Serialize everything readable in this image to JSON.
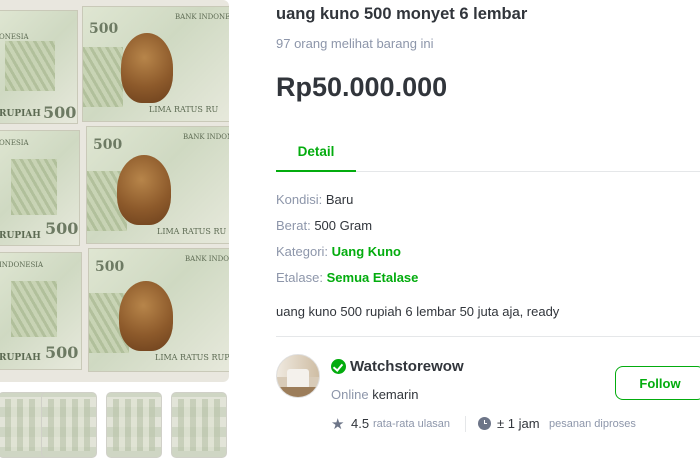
{
  "product": {
    "title": "uang kuno 500 monyet 6 lembar",
    "views": "97 orang melihat barang ini",
    "price": "Rp50.000.000"
  },
  "tabs": {
    "detail": "Detail"
  },
  "specs": {
    "condition": {
      "label": "Kondisi:",
      "value": "Baru"
    },
    "weight": {
      "label": "Berat:",
      "value": "500 Gram"
    },
    "category": {
      "label": "Kategori:",
      "value": "Uang Kuno"
    },
    "showcase": {
      "label": "Etalase:",
      "value": "Semua Etalase"
    }
  },
  "description": "uang kuno 500 rupiah 6 lembar 50 juta aja, ready",
  "banknote": {
    "bank": "BANK INDONESIA",
    "words": "LIMA RATUS RUPIAH",
    "rupiah": "RUPIAH",
    "denomination": "500",
    "partial_bank": "BANK INDONE",
    "partial_words": "LIMA RATUS RU",
    "partial_words_2": "LIMA RATUS RUPI",
    "partial_left_bank": "ONESIA",
    "partial_left_bank_2": "INDONESIA"
  },
  "shop": {
    "name": "Watchstorewow",
    "online_label": "Online",
    "online_value": "kemarin",
    "follow_label": "Follow",
    "rating": "4.5",
    "rating_label": "rata-rata ulasan",
    "process_time": "± 1 jam",
    "process_label": "pesanan diproses",
    "badge_icon": "verified-badge-icon",
    "accent_color": "#03ac0e"
  }
}
